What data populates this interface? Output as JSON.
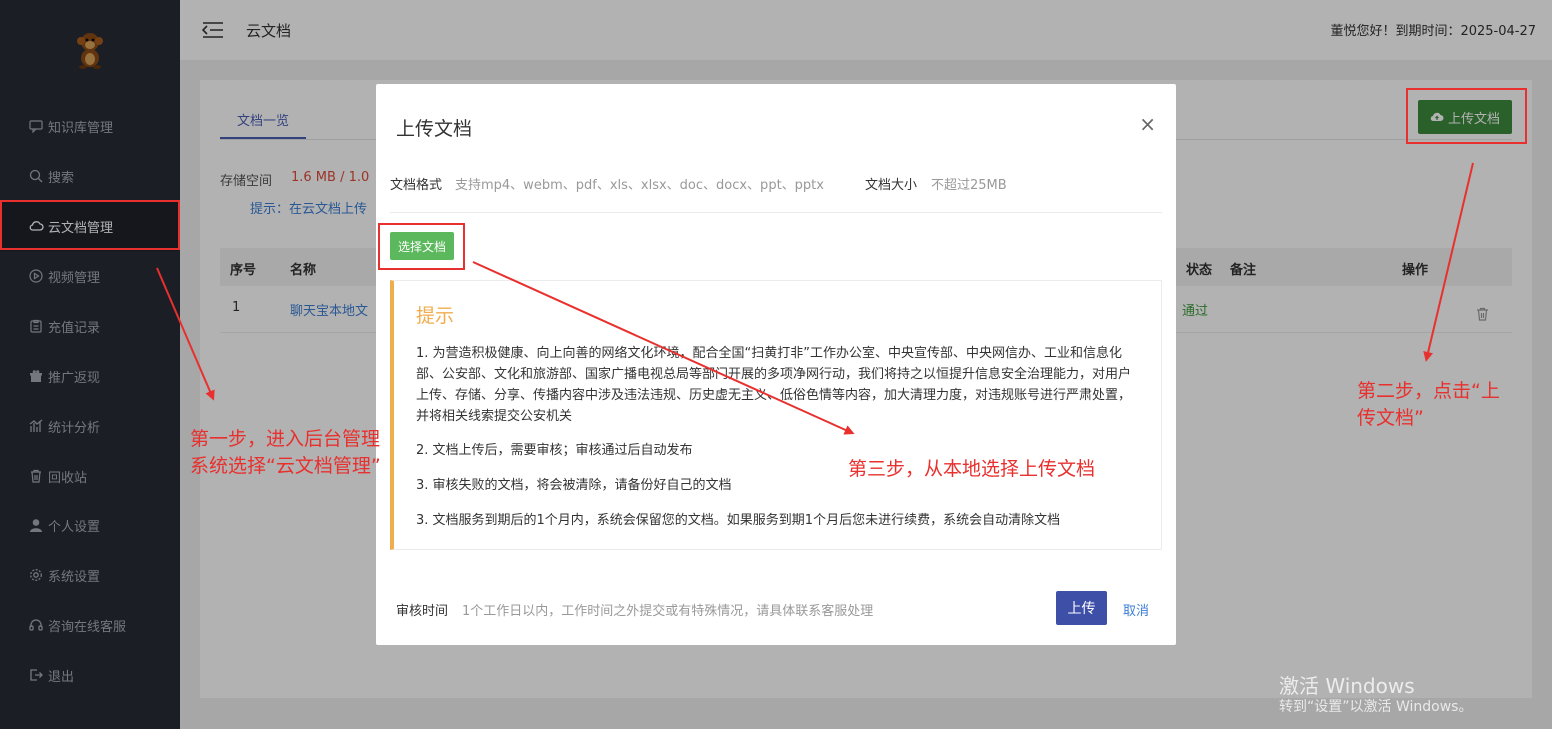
{
  "sidebar": {
    "items": [
      {
        "label": "知识库管理",
        "icon": "chat-icon"
      },
      {
        "label": "搜索",
        "icon": "search-icon"
      },
      {
        "label": "云文档管理",
        "icon": "cloud-icon"
      },
      {
        "label": "视频管理",
        "icon": "play-icon"
      },
      {
        "label": "充值记录",
        "icon": "clipboard-icon"
      },
      {
        "label": "推广返现",
        "icon": "gift-icon"
      },
      {
        "label": "统计分析",
        "icon": "chart-icon"
      },
      {
        "label": "回收站",
        "icon": "trash-icon"
      },
      {
        "label": "个人设置",
        "icon": "user-icon"
      },
      {
        "label": "系统设置",
        "icon": "gear-icon"
      },
      {
        "label": "咨询在线客服",
        "icon": "headset-icon"
      },
      {
        "label": "退出",
        "icon": "logout-icon"
      }
    ],
    "active_index": 2
  },
  "header": {
    "title": "云文档",
    "greeting": "董悦您好！到期时间：2025-04-27"
  },
  "content": {
    "tab_label": "文档一览",
    "storage_label": "存储空间",
    "storage_value": "1.6 MB / 1.0",
    "hint": "提示：在云文档上传",
    "upload_button": "上传文档",
    "table": {
      "headers": [
        "序号",
        "名称",
        "状态",
        "备注",
        "操作"
      ],
      "rows": [
        {
          "index": "1",
          "name": "聊天宝本地文",
          "status": "通过"
        }
      ]
    }
  },
  "modal": {
    "title": "上传文档",
    "close": "×",
    "format_label": "文档格式",
    "format_value": "支持mp4、webm、pdf、xls、xlsx、doc、docx、ppt、pptx",
    "size_label": "文档大小",
    "size_value": "不超过25MB",
    "choose_button": "选择文档",
    "notice_title": "提示",
    "notices": [
      "1. 为营造积极健康、向上向善的网络文化环境，配合全国“扫黄打非”工作办公室、中央宣传部、中央网信办、工业和信息化部、公安部、文化和旅游部、国家广播电视总局等部门开展的多项净网行动，我们将持之以恒提升信息安全治理能力，对用户上传、存储、分享、传播内容中涉及违法违规、历史虚无主义、低俗色情等内容，加大清理力度，对违规账号进行严肃处置，并将相关线索提交公安机关",
      "2. 文档上传后，需要审核；审核通过后自动发布",
      "3. 审核失败的文档，将会被清除，请备份好自己的文档",
      "3. 文档服务到期后的1个月内，系统会保留您的文档。如果服务到期1个月后您未进行续费，系统会自动清除文档"
    ],
    "audit_label": "审核时间",
    "audit_value": "1个工作日以内，工作时间之外提交或有特殊情况，请具体联系客服处理",
    "submit_button": "上传",
    "cancel_link": "取消"
  },
  "annotations": {
    "step1": "第一步，进入后台管理系统选择“云文档管理”",
    "step1_line1": "第一步，进入后台管理",
    "step1_line2": "系统选择“云文档管理”",
    "step2_line1": "第二步，点击“上",
    "step2_line2": "传文档”",
    "step3": "第三步，从本地选择上传文档"
  },
  "watermark": {
    "line1": "激活 Windows",
    "line2": "转到“设置”以激活 Windows。"
  },
  "colors": {
    "sidebar_bg": "#282c36",
    "accent_blue": "#3e4fa8",
    "green": "#5cb85c",
    "annotation_red": "#e8302e",
    "notice_orange": "#f0ad4e"
  }
}
